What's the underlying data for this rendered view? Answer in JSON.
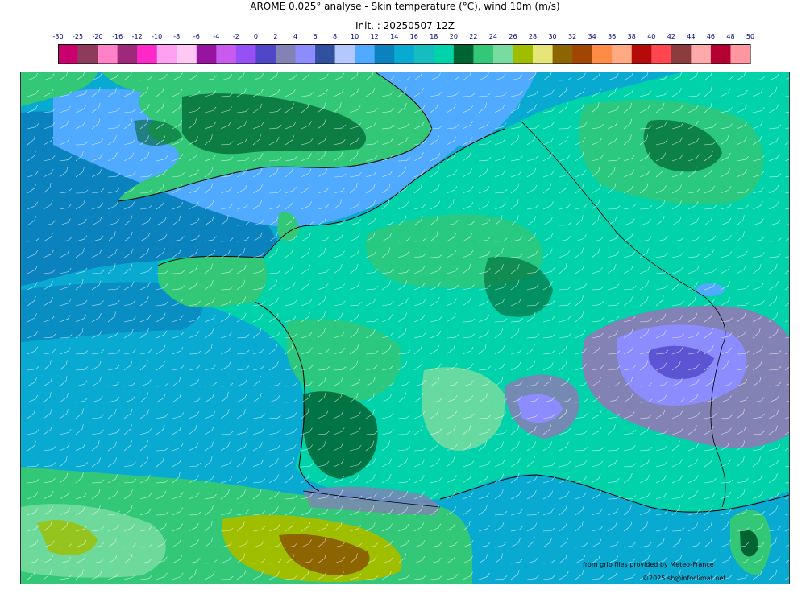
{
  "header": {
    "title": "AROME 0.025° analyse - Skin temperature (°C), wind 10m (m/s)",
    "init": "Init. : 20250507 12Z"
  },
  "colorbar": {
    "ticks": [
      "-30",
      "-25",
      "-20",
      "-16",
      "-12",
      "-10",
      "-8",
      "-6",
      "-4",
      "-2",
      "0",
      "2",
      "4",
      "6",
      "8",
      "10",
      "12",
      "14",
      "16",
      "18",
      "20",
      "22",
      "24",
      "26",
      "28",
      "30",
      "32",
      "34",
      "36",
      "38",
      "40",
      "42",
      "44",
      "46",
      "48",
      "50"
    ],
    "colors": [
      "#c8006e",
      "#8c3c5a",
      "#ff82c8",
      "#a0287a",
      "#ff28c8",
      "#ffa0f0",
      "#ffc8f5",
      "#9614a0",
      "#c85af0",
      "#9650f5",
      "#5046c8",
      "#8282b4",
      "#8c8cff",
      "#3250a0",
      "#b4c8ff",
      "#50aaff",
      "#0a82be",
      "#08aad2",
      "#14bebe",
      "#00d2aa",
      "#006432",
      "#32c878",
      "#78dca0",
      "#a0be00",
      "#e6e678",
      "#8c6400",
      "#a04600",
      "#ff8c46",
      "#ffaa82",
      "#b40a0a",
      "#ff4650",
      "#8c3c3c",
      "#ffaaaa",
      "#b40032",
      "#ff96a0"
    ]
  },
  "map": {
    "features": [
      "land-warm-green",
      "ocean-cool-blue",
      "alps-cold-purple",
      "pyrenees-hot-spain",
      "wind-barbs"
    ],
    "colors": {
      "ocean_deep": "#0a82be",
      "ocean": "#08aad2",
      "channel": "#50aaff",
      "land": "#00d2aa",
      "land_warm": "#32c878",
      "forest": "#006432",
      "alps": "#8282b4",
      "alps_snow": "#8c8cff",
      "spain_hot": "#a0be00",
      "spain_hotter": "#8c6400",
      "barb": "#ffffff"
    }
  },
  "credits": {
    "source": "from grib files provided by Meteo-France",
    "copyright": "©2025 sb@infoclimat.net"
  }
}
